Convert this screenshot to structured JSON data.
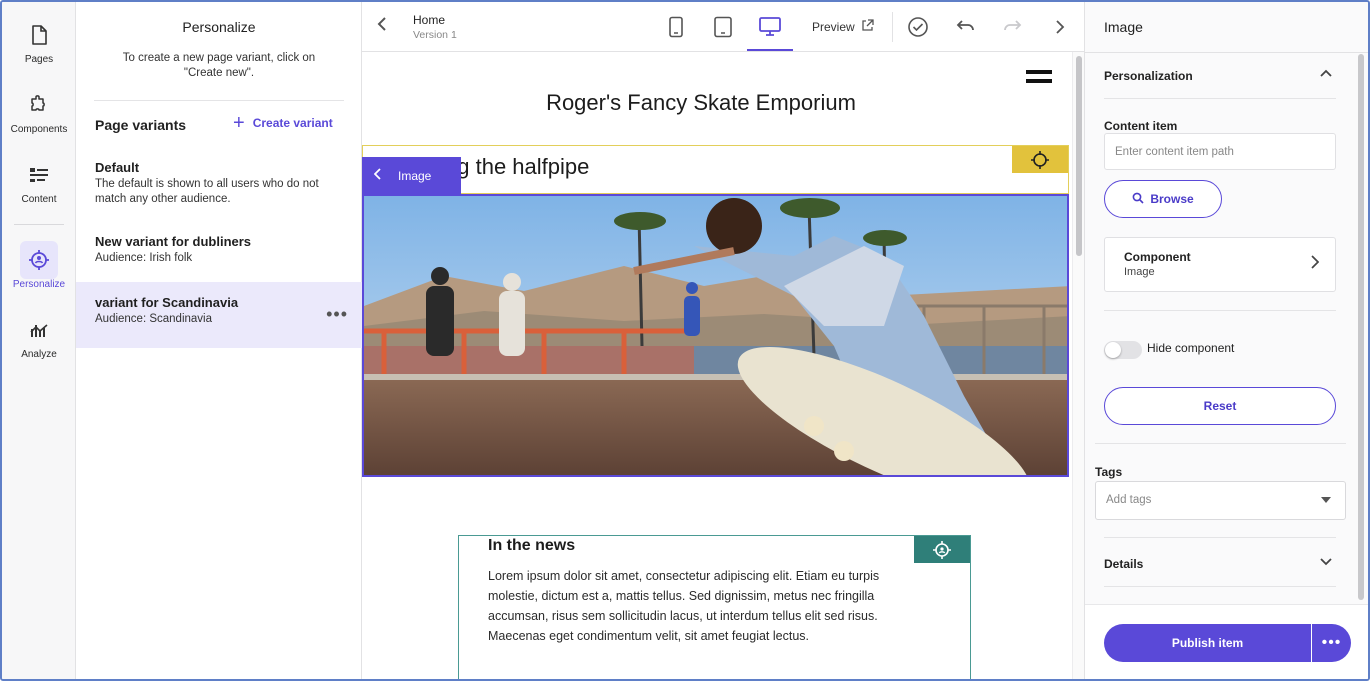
{
  "rail": {
    "items": [
      {
        "label": "Pages",
        "icon": "document-icon"
      },
      {
        "label": "Components",
        "icon": "puzzle-icon"
      },
      {
        "label": "Content",
        "icon": "content-list-icon"
      },
      {
        "label": "Personalize",
        "icon": "target-icon",
        "active": true
      },
      {
        "label": "Analyze",
        "icon": "analytics-icon"
      }
    ]
  },
  "panel": {
    "title": "Personalize",
    "help": "To create a new page variant, click on \"Create new\".",
    "variants_title": "Page variants",
    "create_label": "Create variant",
    "variants": [
      {
        "name": "Default",
        "desc": "The default is shown to all users who do not match any other audience."
      },
      {
        "name": "New variant for dubliners",
        "desc": "Audience: Irish folk"
      },
      {
        "name": "variant for Scandinavia",
        "desc": "Audience: Scandinavia",
        "selected": true
      }
    ]
  },
  "toolbar": {
    "page": "Home",
    "version": "Version 1",
    "preview": "Preview"
  },
  "canvas": {
    "site_title": "Roger's Fancy Skate Emporium",
    "heading": "Rocking the halfpipe",
    "image_tag": "Image",
    "news_title": "In the news",
    "news_body": "Lorem ipsum dolor sit amet, consectetur adipiscing elit. Etiam eu turpis molestie, dictum est a, mattis tellus. Sed dignissim, metus nec fringilla accumsan, risus sem sollicitudin lacus, ut interdum tellus elit sed risus. Maecenas eget condimentum velit, sit amet feugiat lectus."
  },
  "inspector": {
    "title": "Image",
    "personalization": "Personalization",
    "content_item_label": "Content item",
    "content_item_placeholder": "Enter content item path",
    "browse": "Browse",
    "component_title": "Component",
    "component_sub": "Image",
    "hide_component": "Hide component",
    "reset": "Reset",
    "tags_label": "Tags",
    "tags_placeholder": "Add tags",
    "details": "Details",
    "publish": "Publish item"
  },
  "colors": {
    "accent": "#5a49d8",
    "selected_bg": "#ebe9fb",
    "heading_marker": "#e2c23c",
    "news_marker": "#2f7f79"
  }
}
